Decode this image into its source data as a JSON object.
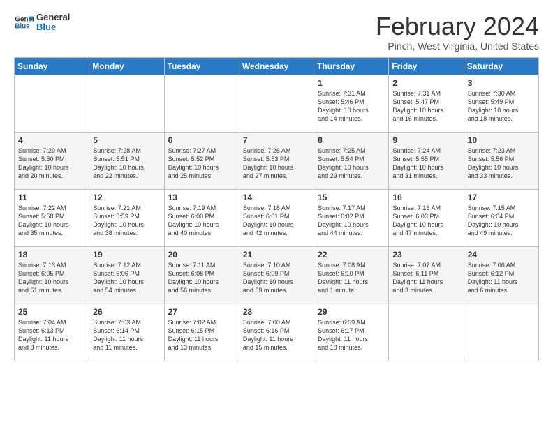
{
  "logo": {
    "text_general": "General",
    "text_blue": "Blue"
  },
  "header": {
    "month": "February 2024",
    "location": "Pinch, West Virginia, United States"
  },
  "days_of_week": [
    "Sunday",
    "Monday",
    "Tuesday",
    "Wednesday",
    "Thursday",
    "Friday",
    "Saturday"
  ],
  "weeks": [
    [
      {
        "day": "",
        "info": ""
      },
      {
        "day": "",
        "info": ""
      },
      {
        "day": "",
        "info": ""
      },
      {
        "day": "",
        "info": ""
      },
      {
        "day": "1",
        "info": "Sunrise: 7:31 AM\nSunset: 5:46 PM\nDaylight: 10 hours\nand 14 minutes."
      },
      {
        "day": "2",
        "info": "Sunrise: 7:31 AM\nSunset: 5:47 PM\nDaylight: 10 hours\nand 16 minutes."
      },
      {
        "day": "3",
        "info": "Sunrise: 7:30 AM\nSunset: 5:49 PM\nDaylight: 10 hours\nand 18 minutes."
      }
    ],
    [
      {
        "day": "4",
        "info": "Sunrise: 7:29 AM\nSunset: 5:50 PM\nDaylight: 10 hours\nand 20 minutes."
      },
      {
        "day": "5",
        "info": "Sunrise: 7:28 AM\nSunset: 5:51 PM\nDaylight: 10 hours\nand 22 minutes."
      },
      {
        "day": "6",
        "info": "Sunrise: 7:27 AM\nSunset: 5:52 PM\nDaylight: 10 hours\nand 25 minutes."
      },
      {
        "day": "7",
        "info": "Sunrise: 7:26 AM\nSunset: 5:53 PM\nDaylight: 10 hours\nand 27 minutes."
      },
      {
        "day": "8",
        "info": "Sunrise: 7:25 AM\nSunset: 5:54 PM\nDaylight: 10 hours\nand 29 minutes."
      },
      {
        "day": "9",
        "info": "Sunrise: 7:24 AM\nSunset: 5:55 PM\nDaylight: 10 hours\nand 31 minutes."
      },
      {
        "day": "10",
        "info": "Sunrise: 7:23 AM\nSunset: 5:56 PM\nDaylight: 10 hours\nand 33 minutes."
      }
    ],
    [
      {
        "day": "11",
        "info": "Sunrise: 7:22 AM\nSunset: 5:58 PM\nDaylight: 10 hours\nand 35 minutes."
      },
      {
        "day": "12",
        "info": "Sunrise: 7:21 AM\nSunset: 5:59 PM\nDaylight: 10 hours\nand 38 minutes."
      },
      {
        "day": "13",
        "info": "Sunrise: 7:19 AM\nSunset: 6:00 PM\nDaylight: 10 hours\nand 40 minutes."
      },
      {
        "day": "14",
        "info": "Sunrise: 7:18 AM\nSunset: 6:01 PM\nDaylight: 10 hours\nand 42 minutes."
      },
      {
        "day": "15",
        "info": "Sunrise: 7:17 AM\nSunset: 6:02 PM\nDaylight: 10 hours\nand 44 minutes."
      },
      {
        "day": "16",
        "info": "Sunrise: 7:16 AM\nSunset: 6:03 PM\nDaylight: 10 hours\nand 47 minutes."
      },
      {
        "day": "17",
        "info": "Sunrise: 7:15 AM\nSunset: 6:04 PM\nDaylight: 10 hours\nand 49 minutes."
      }
    ],
    [
      {
        "day": "18",
        "info": "Sunrise: 7:13 AM\nSunset: 6:05 PM\nDaylight: 10 hours\nand 51 minutes."
      },
      {
        "day": "19",
        "info": "Sunrise: 7:12 AM\nSunset: 6:06 PM\nDaylight: 10 hours\nand 54 minutes."
      },
      {
        "day": "20",
        "info": "Sunrise: 7:11 AM\nSunset: 6:08 PM\nDaylight: 10 hours\nand 56 minutes."
      },
      {
        "day": "21",
        "info": "Sunrise: 7:10 AM\nSunset: 6:09 PM\nDaylight: 10 hours\nand 59 minutes."
      },
      {
        "day": "22",
        "info": "Sunrise: 7:08 AM\nSunset: 6:10 PM\nDaylight: 11 hours\nand 1 minute."
      },
      {
        "day": "23",
        "info": "Sunrise: 7:07 AM\nSunset: 6:11 PM\nDaylight: 11 hours\nand 3 minutes."
      },
      {
        "day": "24",
        "info": "Sunrise: 7:06 AM\nSunset: 6:12 PM\nDaylight: 11 hours\nand 6 minutes."
      }
    ],
    [
      {
        "day": "25",
        "info": "Sunrise: 7:04 AM\nSunset: 6:13 PM\nDaylight: 11 hours\nand 8 minutes."
      },
      {
        "day": "26",
        "info": "Sunrise: 7:03 AM\nSunset: 6:14 PM\nDaylight: 11 hours\nand 11 minutes."
      },
      {
        "day": "27",
        "info": "Sunrise: 7:02 AM\nSunset: 6:15 PM\nDaylight: 11 hours\nand 13 minutes."
      },
      {
        "day": "28",
        "info": "Sunrise: 7:00 AM\nSunset: 6:16 PM\nDaylight: 11 hours\nand 15 minutes."
      },
      {
        "day": "29",
        "info": "Sunrise: 6:59 AM\nSunset: 6:17 PM\nDaylight: 11 hours\nand 18 minutes."
      },
      {
        "day": "",
        "info": ""
      },
      {
        "day": "",
        "info": ""
      }
    ]
  ]
}
